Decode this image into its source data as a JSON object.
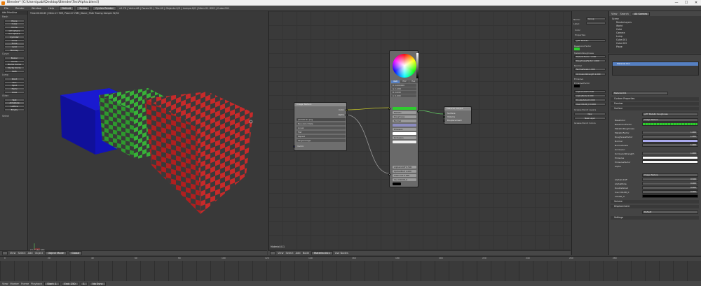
{
  "window": {
    "title": "Blender* [C:\\Users\\pabl\\Desktop\\Blender\\TestAlpha.blend]",
    "controls": [
      "—",
      "☐",
      "✕"
    ]
  },
  "topbar": {
    "menus": [
      "File",
      "Render",
      "Window",
      "Help"
    ],
    "layout": "Default",
    "scene": "Scene",
    "engine": "Cycles Render",
    "stats": "v2.79 | Verts:48 | Faces:21 | Tris:42 | Objects:0/3 | Lamps:0/0 | Mem:21.32M | Cube.001"
  },
  "toolshelf": {
    "header": "Add Primitive",
    "sections": [
      {
        "title": "Mesh",
        "buttons": [
          "Plane",
          "Cube",
          "Circle",
          "UV Sphere",
          "Ico Sphere",
          "Cylinder",
          "Cone",
          "Torus",
          "Grid",
          "Monkey"
        ]
      },
      {
        "title": "Curve",
        "buttons": [
          "Bezier",
          "Circle",
          "Nurbs Curve",
          "Nurbs Circle",
          "Path"
        ]
      },
      {
        "title": "Lamp",
        "buttons": [
          "Point",
          "Sun",
          "Spot",
          "Hemi",
          "Area"
        ]
      },
      {
        "title": "Other",
        "buttons": [
          "Text",
          "Armature",
          "Lattice",
          "Empty"
        ]
      }
    ],
    "footer": "Select"
  },
  "viewport": {
    "info": "Time:00:00.65 | Mem:17.70M, Peak:27.78M | Done | Path Tracing Sample 32/32",
    "object_label": "(1) Cube.001",
    "menus": [
      "View",
      "Select",
      "Add",
      "Object"
    ],
    "mode": "Object Mode",
    "layer": "Global"
  },
  "node_editor": {
    "image_node": {
      "title": "Image Texture",
      "out1": "Color",
      "out2": "Alpha",
      "image": "pedestrian.png",
      "opts": [
        "Non-Color Data",
        "Linear",
        "Flat",
        "Repeat",
        "Single Image"
      ],
      "in1": "Vector"
    },
    "bsdf_node": {
      "rows": [
        "Base Color",
        "Metallic",
        "Roughness",
        "Normal",
        "Emissive",
        "Occlusion",
        "AlphaCutoff 0.500",
        "OpticalMult 1.000",
        "Clearcoat 0.000",
        "Use COLOR_0"
      ]
    },
    "output_node": {
      "title": "Material Output",
      "rows": [
        "Surface",
        "Volume",
        "Displacement"
      ]
    },
    "picker": {
      "tabs": [
        "RGB",
        "HSV",
        "Hex"
      ],
      "values": [
        "R: 0.000000",
        "G: 1.000",
        "B: 0.000",
        "A: 1.000"
      ]
    },
    "label": "Material.011",
    "menus": [
      "View",
      "Select",
      "Add",
      "Node"
    ],
    "material": "Material.011",
    "use_nodes": "Use Nodes"
  },
  "npanel": {
    "items": [
      {
        "label": "Name:",
        "value": "Group"
      },
      {
        "label": "Label:",
        "value": ""
      },
      {
        "label": "Color",
        "value": ""
      },
      {
        "label": "Properties",
        "value": ""
      },
      {
        "label": "glTF Metallic",
        "value": ""
      },
      {
        "label": "BaseColorFactor",
        "value": ""
      },
      {
        "label": "MetallicRoughness",
        "value": ""
      },
      {
        "label": "MetallicFactor",
        "value": "1.000"
      },
      {
        "label": "RoughnessFactor",
        "value": "1.000"
      },
      {
        "label": "Normal",
        "value": ""
      },
      {
        "label": "NormalScale",
        "value": "1.000"
      },
      {
        "label": "OcclusionStrength",
        "value": "1.000"
      },
      {
        "label": "Emissive",
        "value": ""
      },
      {
        "label": "EmissiveFactor",
        "value": ""
      },
      {
        "label": "AlphaCutoff",
        "value": "0.500"
      },
      {
        "label": "AlphaMode",
        "value": "0.000"
      },
      {
        "label": "DoubleSided",
        "value": "0.000"
      },
      {
        "label": "Use COLOR_0",
        "value": "0.000"
      },
      {
        "label": "Grease Pencil Layers",
        "value": ""
      },
      {
        "label": "New",
        "value": ""
      },
      {
        "label": "New Layer",
        "value": ""
      },
      {
        "label": "Grease Pencil Colors",
        "value": ""
      }
    ]
  },
  "outliner": {
    "menus": [
      "View",
      "Search",
      "All Scenes"
    ],
    "rows": [
      "Scene",
      "RenderLayers",
      "World",
      "Cube",
      "Camera",
      "Lamp",
      "Cube.001",
      "Cube.002",
      "Plane"
    ]
  },
  "properties": {
    "material_slot": "Material.011",
    "sections": [
      "Custom Properties",
      "Preview",
      "Surface",
      "Volume",
      "Displacement",
      "Settings"
    ],
    "surface_shader": "glTF Metallic Roughness",
    "rows": [
      {
        "label": "BaseColor",
        "value": "Image Texture"
      },
      {
        "label": "BaseColorFactor",
        "value": ""
      },
      {
        "label": "MetallicRoughness",
        "value": ""
      },
      {
        "label": "MetallicFactor",
        "value": "1.000"
      },
      {
        "label": "RoughnessFactor",
        "value": "1.000"
      },
      {
        "label": "Normal",
        "value": ""
      },
      {
        "label": "NormalScale",
        "value": "1.000"
      },
      {
        "label": "Occlusion",
        "value": ""
      },
      {
        "label": "OcclusionStrength",
        "value": "1.000"
      },
      {
        "label": "Emissive",
        "value": ""
      },
      {
        "label": "EmissiveFactor",
        "value": ""
      },
      {
        "label": "Alpha",
        "value": "Image Texture"
      },
      {
        "label": "AlphaCutoff",
        "value": "0.500"
      },
      {
        "label": "AlphaMode",
        "value": "0.000"
      },
      {
        "label": "DoubleSided",
        "value": "0.000"
      },
      {
        "label": "Use COLOR_0",
        "value": "0.000"
      },
      {
        "label": "COLOR_0",
        "value": ""
      }
    ],
    "displacement": "Default"
  },
  "timeline": {
    "menus": [
      "View",
      "Marker",
      "Frame",
      "Playback"
    ],
    "start": "Start: 1",
    "end": "End: 250",
    "current": "1",
    "sync": "No Sync",
    "ticks": [
      "0",
      "20",
      "40",
      "60",
      "80",
      "100",
      "120",
      "140",
      "160",
      "180",
      "200",
      "220",
      "240",
      "260",
      "280"
    ]
  },
  "colors": {
    "red": "#b01f1f",
    "green": "#2e9a2e",
    "blue": "#1010a8",
    "accent": "#5680c2"
  }
}
